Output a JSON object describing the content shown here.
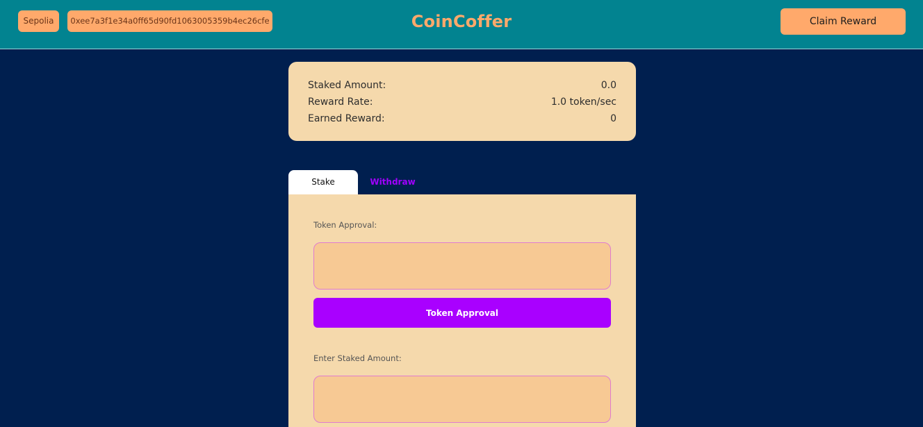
{
  "header": {
    "network_label": "Sepolia",
    "wallet_address": "0xee7a3f1e34a0ff65d90fd1063005359b4ec26cfe",
    "brand": "CoinCoffer",
    "claim_button": "Claim Reward"
  },
  "stats": [
    {
      "label": "Staked Amount:",
      "value": "0.0"
    },
    {
      "label": "Reward Rate:",
      "value": "1.0 token/sec"
    },
    {
      "label": "Earned Reward:",
      "value": "0"
    }
  ],
  "tabs": [
    {
      "label": "Stake",
      "active": true
    },
    {
      "label": "Withdraw",
      "active": false
    }
  ],
  "stake_form": {
    "approval_label": "Token Approval:",
    "approval_value": "",
    "approval_button": "Token Approval",
    "amount_label": "Enter Staked Amount:",
    "amount_value": ""
  },
  "colors": {
    "page_background": "#001f4f",
    "header_background": "#028390",
    "accent_orange": "#ffa96b",
    "card_background": "#f5d9ac",
    "input_background": "#f7c994",
    "primary_purple": "#a900ff"
  }
}
